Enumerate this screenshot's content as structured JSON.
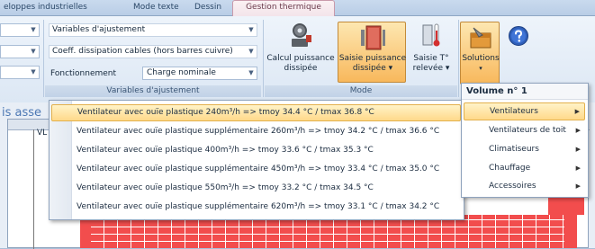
{
  "tabs": {
    "items": [
      "eloppes industrielles",
      "Mode texte",
      "Dessin"
    ],
    "active": "Gestion thermique"
  },
  "ribbon": {
    "variables": {
      "combo1": "Variables d'ajustement",
      "combo2": "Coeff. dissipation cables (hors barres cuivre)",
      "fonctionnement_label": "Fonctionnement",
      "fonctionnement_value": "Charge nominale",
      "group_label": "Variables d'ajustement"
    },
    "mode": {
      "calcul_line1": "Calcul puissance",
      "calcul_line2": "dissipée",
      "saisie_line1": "Saisie puissance",
      "saisie_line2": "dissipée ▾",
      "releve_line1": "Saisie T°",
      "releve_line2": "relevée ▾",
      "group_label": "Mode"
    },
    "solutions": {
      "label": "Solutions",
      "caret": "▾"
    }
  },
  "workspace": {
    "left_text": "is asse",
    "vu_text": "VL"
  },
  "volume_menu": {
    "title": "Volume n° 1",
    "items": [
      "Ventilateurs",
      "Ventilateurs de toit",
      "Climatiseurs",
      "Chauffage",
      "Accessoires"
    ]
  },
  "ventilator_menu": {
    "items": [
      "Ventilateur avec ouïe plastique 240m³/h => tmoy 34.4 °C / tmax 36.8 °C",
      "Ventilateur avec ouïe plastique supplémentaire 260m³/h => tmoy 34.2 °C / tmax 36.6 °C",
      "Ventilateur avec ouïe plastique 400m³/h => tmoy 33.6 °C / tmax 35.3 °C",
      "Ventilateur avec ouïe plastique supplémentaire 450m³/h => tmoy 33.4 °C / tmax 35.0 °C",
      "Ventilateur avec ouïe plastique 550m³/h => tmoy 33.2 °C / tmax 34.5 °C",
      "Ventilateur avec ouïe plastique supplémentaire 620m³/h => tmoy 33.1 °C / tmax 34.2 °C"
    ]
  },
  "colors": {
    "accent_highlight": "#ffd98a",
    "red_zone": "#f24d4d",
    "ribbon_bg": "#dce7f4"
  }
}
